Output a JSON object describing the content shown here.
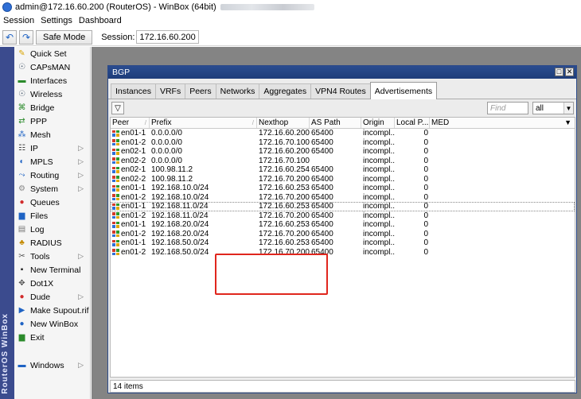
{
  "window": {
    "title": "admin@172.16.60.200 (RouterOS) - WinBox (64bit)"
  },
  "menubar": {
    "items": [
      "Session",
      "Settings",
      "Dashboard"
    ]
  },
  "toolbar": {
    "undo_icon": "undo-icon",
    "redo_icon": "redo-icon",
    "safe_mode_label": "Safe Mode",
    "session_label": "Session:",
    "session_value": "172.16.60.200"
  },
  "vertical_strip": {
    "label": "RouterOS WinBox"
  },
  "sidebar": {
    "items": [
      {
        "label": "Quick Set",
        "icon": "quick-set-icon",
        "submenu": false
      },
      {
        "label": "CAPsMAN",
        "icon": "capsman-icon",
        "submenu": false
      },
      {
        "label": "Interfaces",
        "icon": "interfaces-icon",
        "submenu": false
      },
      {
        "label": "Wireless",
        "icon": "wireless-icon",
        "submenu": false
      },
      {
        "label": "Bridge",
        "icon": "bridge-icon",
        "submenu": false
      },
      {
        "label": "PPP",
        "icon": "ppp-icon",
        "submenu": false
      },
      {
        "label": "Mesh",
        "icon": "mesh-icon",
        "submenu": false
      },
      {
        "label": "IP",
        "icon": "ip-icon",
        "submenu": true
      },
      {
        "label": "MPLS",
        "icon": "mpls-icon",
        "submenu": true
      },
      {
        "label": "Routing",
        "icon": "routing-icon",
        "submenu": true
      },
      {
        "label": "System",
        "icon": "system-icon",
        "submenu": true
      },
      {
        "label": "Queues",
        "icon": "queues-icon",
        "submenu": false
      },
      {
        "label": "Files",
        "icon": "files-icon",
        "submenu": false
      },
      {
        "label": "Log",
        "icon": "log-icon",
        "submenu": false
      },
      {
        "label": "RADIUS",
        "icon": "radius-icon",
        "submenu": false
      },
      {
        "label": "Tools",
        "icon": "tools-icon",
        "submenu": true
      },
      {
        "label": "New Terminal",
        "icon": "terminal-icon",
        "submenu": false
      },
      {
        "label": "Dot1X",
        "icon": "dot1x-icon",
        "submenu": false
      },
      {
        "label": "Dude",
        "icon": "dude-icon",
        "submenu": true
      },
      {
        "label": "Make Supout.rif",
        "icon": "supout-icon",
        "submenu": false
      },
      {
        "label": "New WinBox",
        "icon": "winbox-icon",
        "submenu": false
      },
      {
        "label": "Exit",
        "icon": "exit-icon",
        "submenu": false
      }
    ],
    "windows_label": "Windows"
  },
  "bgp_window": {
    "title": "BGP",
    "tabs": [
      "Instances",
      "VRFs",
      "Peers",
      "Networks",
      "Aggregates",
      "VPN4 Routes",
      "Advertisements"
    ],
    "active_tab": "Advertisements",
    "find_placeholder": "Find",
    "filter_value": "all",
    "columns": [
      "Peer",
      "Prefix",
      "Nexthop",
      "AS Path",
      "Origin",
      "Local P...",
      "MED"
    ],
    "rows": [
      {
        "peer": "en01-1",
        "prefix": "0.0.0.0/0",
        "nexthop": "172.16.60.200",
        "as_path": "65400",
        "origin": "incompl...",
        "local_pref": "0",
        "med": ""
      },
      {
        "peer": "en01-2",
        "prefix": "0.0.0.0/0",
        "nexthop": "172.16.70.100",
        "as_path": "65400",
        "origin": "incompl...",
        "local_pref": "0",
        "med": ""
      },
      {
        "peer": "en02-1",
        "prefix": "0.0.0.0/0",
        "nexthop": "172.16.60.200",
        "as_path": "65400",
        "origin": "incompl...",
        "local_pref": "0",
        "med": ""
      },
      {
        "peer": "en02-2",
        "prefix": "0.0.0.0/0",
        "nexthop": "172.16.70.100",
        "as_path": "",
        "origin": "incompl...",
        "local_pref": "0",
        "med": ""
      },
      {
        "peer": "en02-1",
        "prefix": "100.98.11.2",
        "nexthop": "172.16.60.254",
        "as_path": "65400",
        "origin": "incompl...",
        "local_pref": "0",
        "med": ""
      },
      {
        "peer": "en02-2",
        "prefix": "100.98.11.2",
        "nexthop": "172.16.70.200",
        "as_path": "65400",
        "origin": "incompl...",
        "local_pref": "0",
        "med": ""
      },
      {
        "peer": "en01-1",
        "prefix": "192.168.10.0/24",
        "nexthop": "172.16.60.253",
        "as_path": "65400",
        "origin": "incompl...",
        "local_pref": "0",
        "med": ""
      },
      {
        "peer": "en01-2",
        "prefix": "192.168.10.0/24",
        "nexthop": "172.16.70.200",
        "as_path": "65400",
        "origin": "incompl...",
        "local_pref": "0",
        "med": ""
      },
      {
        "peer": "en01-1",
        "prefix": "192.168.11.0/24",
        "nexthop": "172.16.60.253",
        "as_path": "65400",
        "origin": "incompl...",
        "local_pref": "0",
        "med": ""
      },
      {
        "peer": "en01-2",
        "prefix": "192.168.11.0/24",
        "nexthop": "172.16.70.200",
        "as_path": "65400",
        "origin": "incompl...",
        "local_pref": "0",
        "med": ""
      },
      {
        "peer": "en01-1",
        "prefix": "192.168.20.0/24",
        "nexthop": "172.16.60.253",
        "as_path": "65400",
        "origin": "incompl...",
        "local_pref": "0",
        "med": ""
      },
      {
        "peer": "en01-2",
        "prefix": "192.168.20.0/24",
        "nexthop": "172.16.70.200",
        "as_path": "65400",
        "origin": "incompl...",
        "local_pref": "0",
        "med": ""
      },
      {
        "peer": "en01-1",
        "prefix": "192.168.50.0/24",
        "nexthop": "172.16.60.253",
        "as_path": "65400",
        "origin": "incompl...",
        "local_pref": "0",
        "med": ""
      },
      {
        "peer": "en01-2",
        "prefix": "192.168.50.0/24",
        "nexthop": "172.16.70.200",
        "as_path": "65400",
        "origin": "incompl...",
        "local_pref": "0",
        "med": ""
      }
    ],
    "selected_row": 8,
    "highlighted_rows": [
      6,
      7,
      8,
      9
    ],
    "highlight_color": "#e0261d",
    "status": "14 items"
  },
  "colors": {
    "window_titlebar": "#1e3d7a",
    "workspace": "#848484",
    "vertical_strip": "#3b4b8e"
  }
}
